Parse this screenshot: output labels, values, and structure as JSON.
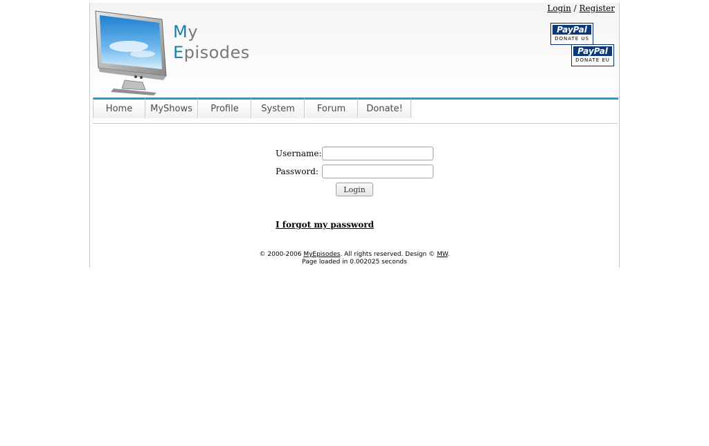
{
  "header": {
    "logo_line1_cap": "M",
    "logo_line1_rest": "y",
    "logo_line2_cap": "E",
    "logo_line2_rest": "pisodes",
    "auth": {
      "login": "Login",
      "separator": " / ",
      "register": "Register"
    },
    "paypal_us": {
      "brand": "PayPal",
      "label": "DONATE US"
    },
    "paypal_eu": {
      "brand": "PayPal",
      "label": "DONATE EU"
    }
  },
  "nav": {
    "tabs": [
      {
        "label": "Home"
      },
      {
        "label": "MyShows"
      },
      {
        "label": "Profile"
      },
      {
        "label": "System"
      },
      {
        "label": "Forum"
      },
      {
        "label": "Donate!"
      }
    ],
    "accent_color": "#19a0c0"
  },
  "login": {
    "username_label": "Username:",
    "username_value": "",
    "password_label": "Password:",
    "password_value": "",
    "submit_label": "Login",
    "forgot_label": "I forgot my password"
  },
  "footer": {
    "copyright_prefix": "© 2000-2006 ",
    "site_link": "MyEpisodes",
    "rights": ". All rights reserved. Design © ",
    "designer_link": "MW",
    "end": ".",
    "load_time": "Page loaded in 0.002025 seconds"
  }
}
